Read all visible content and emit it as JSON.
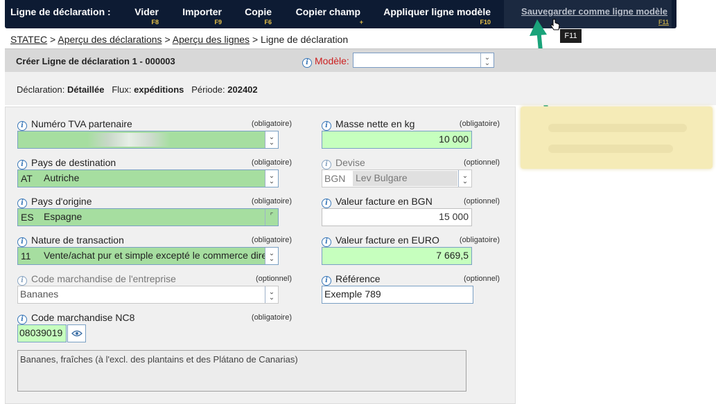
{
  "toolbar": {
    "title": "Ligne de déclaration :",
    "buttons": [
      {
        "label": "Vider",
        "key": "F8"
      },
      {
        "label": "Importer",
        "key": "F9"
      },
      {
        "label": "Copie",
        "key": "F6"
      },
      {
        "label": "Copier champ",
        "key": "+"
      },
      {
        "label": "Appliquer ligne modèle",
        "key": "F10"
      },
      {
        "label": "Sauvegarder comme ligne modèle",
        "key": "F11"
      }
    ],
    "tooltip": "F11"
  },
  "breadcrumb": {
    "items": [
      "STATEC",
      "Aperçu des déclarations",
      "Aperçu des lignes"
    ],
    "current": "Ligne de déclaration",
    "separator": ">"
  },
  "header": {
    "title": "Créer Ligne de déclaration 1 - 000003",
    "modele_label": "Modèle:",
    "modele_value": ""
  },
  "summary": {
    "declaration_label": "Déclaration:",
    "declaration_value": "Détaillée",
    "flux_label": "Flux:",
    "flux_value": "expéditions",
    "periode_label": "Période:",
    "periode_value": "202402"
  },
  "fields": {
    "tva": {
      "label": "Numéro TVA partenaire",
      "req": "(obligatoire)",
      "value": ""
    },
    "destination": {
      "label": "Pays de destination",
      "req": "(obligatoire)",
      "code": "AT",
      "value": "Autriche"
    },
    "origine": {
      "label": "Pays d'origine",
      "req": "(obligatoire)",
      "code": "ES",
      "value": "Espagne"
    },
    "transaction": {
      "label": "Nature de transaction",
      "req": "(obligatoire)",
      "code": "11",
      "value": "Vente/achat pur et simple excepté le commerce direct"
    },
    "code_entreprise": {
      "label": "Code marchandise de l'entreprise",
      "req": "(optionnel)",
      "value": "Bananes"
    },
    "nc8": {
      "label": "Code marchandise NC8",
      "req": "(obligatoire)",
      "value": "08039019"
    },
    "masse": {
      "label": "Masse nette en kg",
      "req": "(obligatoire)",
      "value": "10 000"
    },
    "devise": {
      "label": "Devise",
      "req": "(optionnel)",
      "code": "BGN",
      "value": "Lev Bulgare"
    },
    "valeur_bgn": {
      "label": "Valeur facture en BGN",
      "req": "(optionnel)",
      "value": "15 000"
    },
    "valeur_euro": {
      "label": "Valeur facture en EURO",
      "req": "(obligatoire)",
      "value": "7 669,5"
    },
    "reference": {
      "label": "Référence",
      "req": "(optionnel)",
      "value": "Exemple 789"
    }
  },
  "description": "Bananes, fraîches (à l'excl. des plantains et des Plátano de Canarias)",
  "colors": {
    "toolbar_bg": "#0d1b33",
    "key_hint": "#e9c34a",
    "required_fill": "#a6dea0",
    "annotation_arrow": "#1aa37a"
  }
}
